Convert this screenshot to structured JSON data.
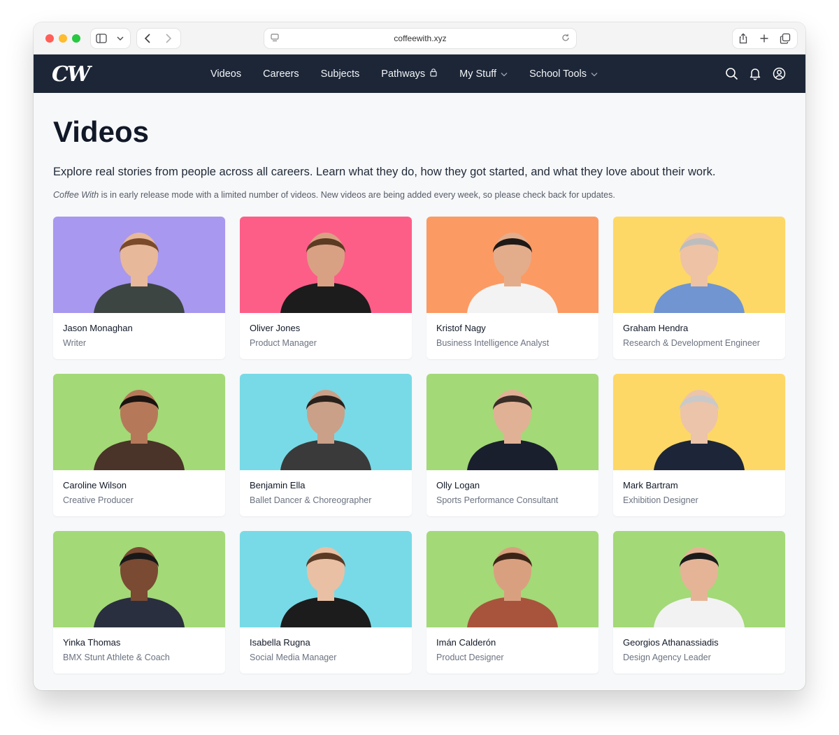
{
  "browser": {
    "url": "coffeewith.xyz"
  },
  "site": {
    "logo_text": "CW",
    "nav": [
      {
        "label": "Videos"
      },
      {
        "label": "Careers"
      },
      {
        "label": "Subjects"
      },
      {
        "label": "Pathways",
        "icon": "lock-icon"
      },
      {
        "label": "My Stuff",
        "icon": "chevron-down-icon"
      },
      {
        "label": "School Tools",
        "icon": "chevron-down-icon"
      }
    ],
    "icons": [
      "search-icon",
      "bell-icon",
      "account-icon"
    ]
  },
  "page": {
    "title": "Videos",
    "intro": "Explore real stories from people across all careers. Learn what they do, how they got started, and what they love about their work.",
    "note_brand": "Coffee With",
    "note_rest": " is in early release mode with a limited number of videos. New videos are being added every week, so please check back for updates."
  },
  "videos": [
    {
      "name": "Jason Monaghan",
      "role": "Writer",
      "bg": "#a898ef"
    },
    {
      "name": "Oliver Jones",
      "role": "Product Manager",
      "bg": "#fd5e88"
    },
    {
      "name": "Kristof Nagy",
      "role": "Business Intelligence Analyst",
      "bg": "#fc9a63"
    },
    {
      "name": "Graham Hendra",
      "role": "Research & Development Engineer",
      "bg": "#fdd866"
    },
    {
      "name": "Caroline Wilson",
      "role": "Creative Producer",
      "bg": "#a3d977"
    },
    {
      "name": "Benjamin Ella",
      "role": "Ballet Dancer & Choreographer",
      "bg": "#78dae6"
    },
    {
      "name": "Olly Logan",
      "role": "Sports Performance Consultant",
      "bg": "#a3d977"
    },
    {
      "name": "Mark Bartram",
      "role": "Exhibition Designer",
      "bg": "#fdd866"
    },
    {
      "name": "Yinka Thomas",
      "role": "BMX Stunt Athlete & Coach",
      "bg": "#a3d977"
    },
    {
      "name": "Isabella Rugna",
      "role": "Social Media Manager",
      "bg": "#78dae6"
    },
    {
      "name": "Imán Calderón",
      "role": "Product Designer",
      "bg": "#a3d977"
    },
    {
      "name": "Georgios Athanassiadis",
      "role": "Design Agency Leader",
      "bg": "#a3d977"
    }
  ]
}
